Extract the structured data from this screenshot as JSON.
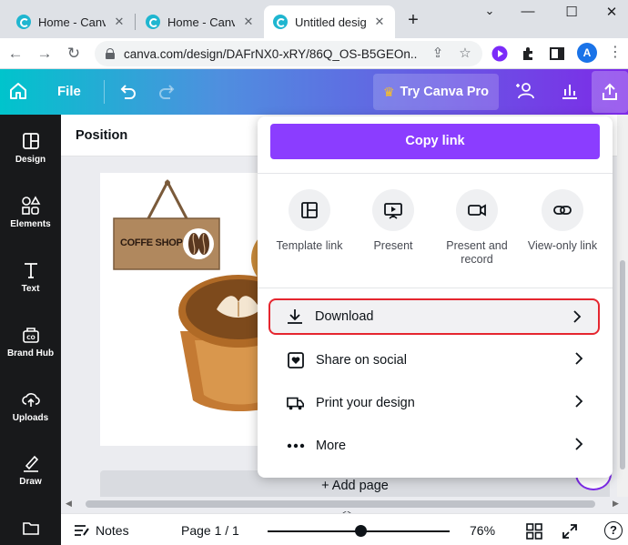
{
  "browser": {
    "tabs": [
      {
        "title": "Home - Canva",
        "close": "✕"
      },
      {
        "title": "Home - Canva",
        "close": "✕"
      },
      {
        "title": "Untitled design",
        "close": "✕"
      }
    ],
    "new_tab": "+",
    "window_controls": {
      "minimize": "—",
      "maximize": "☐",
      "close": "✕"
    },
    "url": "canva.com/design/DAFrNX0-xRY/86Q_OS-B5GEOn...",
    "profile_initial": "A"
  },
  "canva_header": {
    "file_label": "File",
    "try_pro_label": "Try Canva Pro",
    "crown_glyph": "♛"
  },
  "sidebar": {
    "items": [
      {
        "label": "Design",
        "icon": "design-icon"
      },
      {
        "label": "Elements",
        "icon": "elements-icon"
      },
      {
        "label": "Text",
        "icon": "text-icon"
      },
      {
        "label": "Brand Hub",
        "icon": "brand-hub-icon"
      },
      {
        "label": "Uploads",
        "icon": "uploads-icon"
      },
      {
        "label": "Draw",
        "icon": "draw-icon"
      },
      {
        "label": "",
        "icon": "projects-icon"
      }
    ]
  },
  "editor": {
    "position_label": "Position",
    "add_page_label": "+ Add page",
    "sign_text": "COFFE SHOP"
  },
  "footer": {
    "notes_label": "Notes",
    "page_label": "Page 1 / 1",
    "zoom_label": "76%",
    "zoom_fraction": 0.5,
    "help_glyph": "?"
  },
  "share_panel": {
    "copy_link_label": "Copy link",
    "options": [
      {
        "label": "Template link",
        "icon": "template-link-icon"
      },
      {
        "label": "Present",
        "icon": "present-icon"
      },
      {
        "label": "Present and record",
        "icon": "present-record-icon"
      },
      {
        "label": "View-only link",
        "icon": "view-only-link-icon"
      }
    ],
    "rows": [
      {
        "label": "Download",
        "icon": "download-icon",
        "highlighted": true
      },
      {
        "label": "Share on social",
        "icon": "share-social-icon",
        "highlighted": false
      },
      {
        "label": "Print your design",
        "icon": "print-truck-icon",
        "highlighted": false
      },
      {
        "label": "More",
        "icon": "more-dots-icon",
        "highlighted": false
      }
    ]
  },
  "colors": {
    "brand_purple": "#8b3dff",
    "highlight_red": "#e5262f",
    "rail_bg": "#18191b",
    "header_gradient_start": "#00c4cc",
    "header_gradient_end": "#7d2ae8"
  }
}
